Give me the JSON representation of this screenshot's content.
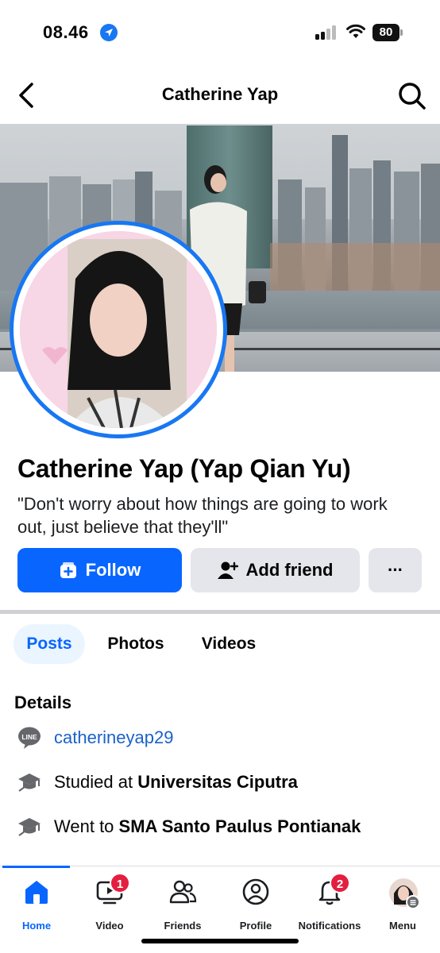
{
  "status_bar": {
    "time": "08.46",
    "battery": "80"
  },
  "header": {
    "title": "Catherine Yap"
  },
  "profile": {
    "name": "Catherine Yap (Yap Qian Yu)",
    "bio": "\"Don't worry about how things are going to work out, just believe that they'll\""
  },
  "actions": {
    "follow": "Follow",
    "add_friend": "Add friend",
    "more": "···"
  },
  "tabs": [
    "Posts",
    "Photos",
    "Videos"
  ],
  "details": {
    "title": "Details",
    "line_id": "catherineyap29",
    "studied_prefix": "Studied at ",
    "studied_school": "Universitas Ciputra",
    "went_prefix": "Went to ",
    "went_school": "SMA Santo Paulus Pontianak"
  },
  "bottom_nav": {
    "items": [
      {
        "label": "Home",
        "icon": "home-icon"
      },
      {
        "label": "Video",
        "icon": "video-icon",
        "badge": "1"
      },
      {
        "label": "Friends",
        "icon": "friends-icon"
      },
      {
        "label": "Profile",
        "icon": "profile-icon"
      },
      {
        "label": "Notifications",
        "icon": "bell-icon",
        "badge": "2"
      },
      {
        "label": "Menu",
        "icon": "menu-avatar-icon"
      }
    ]
  },
  "colors": {
    "accent": "#0866ff",
    "badge": "#e41e3f",
    "button_gray": "#e4e6eb"
  }
}
